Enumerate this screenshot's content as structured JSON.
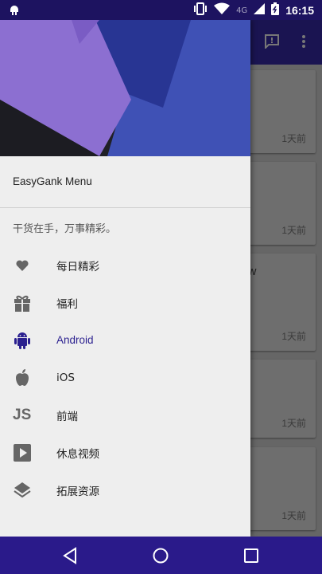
{
  "status_bar": {
    "time": "16:15",
    "network": "4G"
  },
  "drawer": {
    "title": "EasyGank Menu",
    "subtitle": "干货在手，万事精彩。",
    "items": [
      {
        "icon": "heart-icon",
        "label": "每日精彩"
      },
      {
        "icon": "gift-icon",
        "label": "福利"
      },
      {
        "icon": "android-icon",
        "label": "Android",
        "active": true
      },
      {
        "icon": "apple-icon",
        "label": "iOS"
      },
      {
        "icon": "js-icon",
        "label": "前端"
      },
      {
        "icon": "play-icon",
        "label": "休息视频"
      },
      {
        "icon": "layers-icon",
        "label": "拓展资源"
      }
    ]
  },
  "background_cards": [
    {
      "time_label": "1天前"
    },
    {
      "time_label": "1天前"
    },
    {
      "time_label": "1天前",
      "text_fragment": "iew"
    },
    {
      "time_label": "1天前"
    },
    {
      "time_label": "1天前"
    }
  ],
  "colors": {
    "accent": "#2a1f8f",
    "status_bar": "#1d1360",
    "nav_bar": "#2a1a8a"
  }
}
